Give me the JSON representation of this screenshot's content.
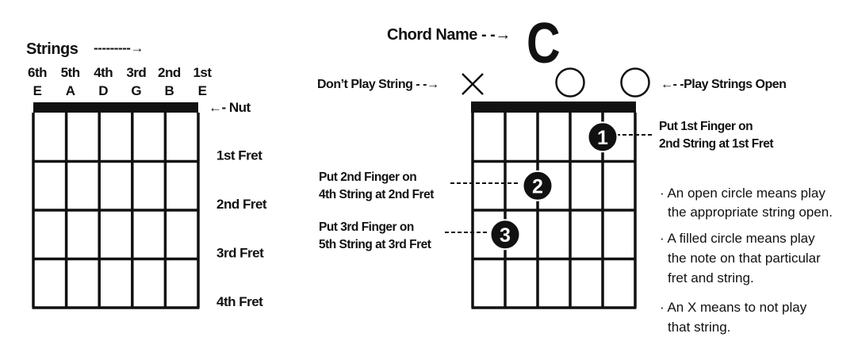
{
  "strings_header": {
    "label": "Strings",
    "arrow": "---------→"
  },
  "string_ordinals": [
    "6th",
    "5th",
    "4th",
    "3rd",
    "2nd",
    "1st"
  ],
  "string_notes": [
    "E",
    "A",
    "D",
    "G",
    "B",
    "E"
  ],
  "nut_label": "←- Nut",
  "fret_labels": [
    "1st Fret",
    "2nd Fret",
    "3rd Fret",
    "4th Fret"
  ],
  "chord": {
    "name_label": "Chord Name - -→",
    "name": "C",
    "dont_play_label": "Don’t Play String - -→",
    "open_label": "←- -Play Strings Open",
    "muted_strings": [
      6
    ],
    "open_strings": [
      3,
      1
    ],
    "fingers": [
      {
        "finger": "1",
        "string": 2,
        "fret": 1
      },
      {
        "finger": "2",
        "string": 4,
        "fret": 2
      },
      {
        "finger": "3",
        "string": 5,
        "fret": 3
      }
    ]
  },
  "callouts": {
    "finger1": [
      "Put 1st Finger on",
      "2nd String at 1st Fret"
    ],
    "finger2": [
      "Put 2nd Finger on",
      "4th String at 2nd Fret"
    ],
    "finger3": [
      "Put 3rd Finger on",
      "5th String at 3rd Fret"
    ]
  },
  "notes": [
    [
      "· An open circle means play",
      "the appropriate string open."
    ],
    [
      "· A filled circle means play",
      "the note on that particular",
      "fret and string."
    ],
    [
      "· An X means to not play",
      "that string."
    ]
  ],
  "colors": {
    "ink": "#111111",
    "background": "#ffffff"
  }
}
